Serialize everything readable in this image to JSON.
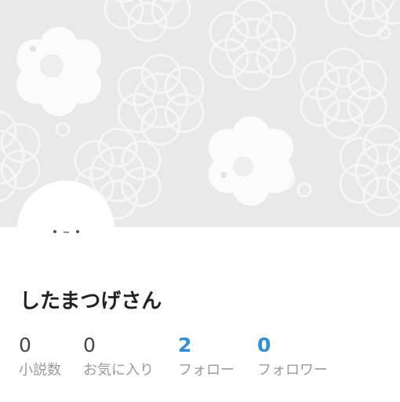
{
  "profile": {
    "display_name": "したまつげさん",
    "cover_color": "#e9e9e9",
    "avatar_icon": "cloud-face-avatar"
  },
  "stats": [
    {
      "value": "0",
      "label": "小説数",
      "highlight": false
    },
    {
      "value": "0",
      "label": "お気に入り",
      "highlight": false
    },
    {
      "value": "2",
      "label": "フォロー",
      "highlight": true
    },
    {
      "value": "0",
      "label": "フォロワー",
      "highlight": true
    }
  ],
  "colors": {
    "accent": "#2f8fd8",
    "text": "#222222",
    "muted": "#9a9a9a"
  }
}
